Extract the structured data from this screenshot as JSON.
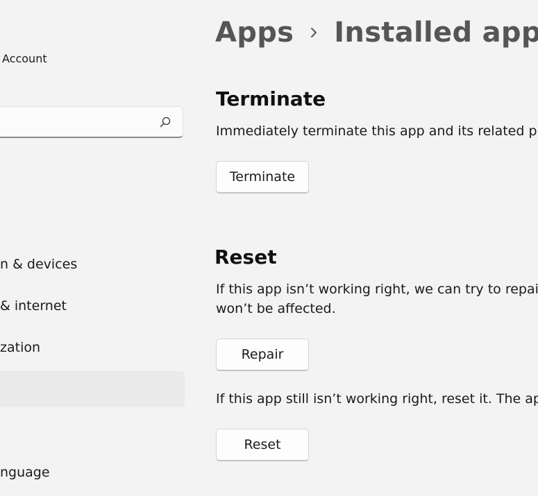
{
  "sidebar": {
    "account_label": "Account",
    "search": {
      "value": "",
      "placeholder": ""
    },
    "items": [
      {
        "label": "n & devices"
      },
      {
        "label": "& internet"
      },
      {
        "label": "zation"
      },
      {
        "label": ""
      },
      {
        "label": "nguage"
      }
    ],
    "selected_index": 3
  },
  "breadcrumb": {
    "items": [
      "Apps",
      "Installed apps"
    ]
  },
  "terminate": {
    "title": "Terminate",
    "description": "Immediately terminate this app and its related pro",
    "button_label": "Terminate"
  },
  "reset": {
    "title": "Reset",
    "description_line1": "If this app isn’t working right, we can try to repair i",
    "description_line2": "won’t be affected.",
    "repair_button_label": "Repair",
    "reset_description": "If this app still isn’t working right, reset it. The app’",
    "reset_button_label": "Reset"
  },
  "icons": {
    "search": "search-icon",
    "breadcrumb_separator": "chevron-right-icon"
  },
  "colors": {
    "background": "#f3f3f3",
    "breadcrumb_text": "#555555",
    "selected_nav": "#eaeaea"
  }
}
